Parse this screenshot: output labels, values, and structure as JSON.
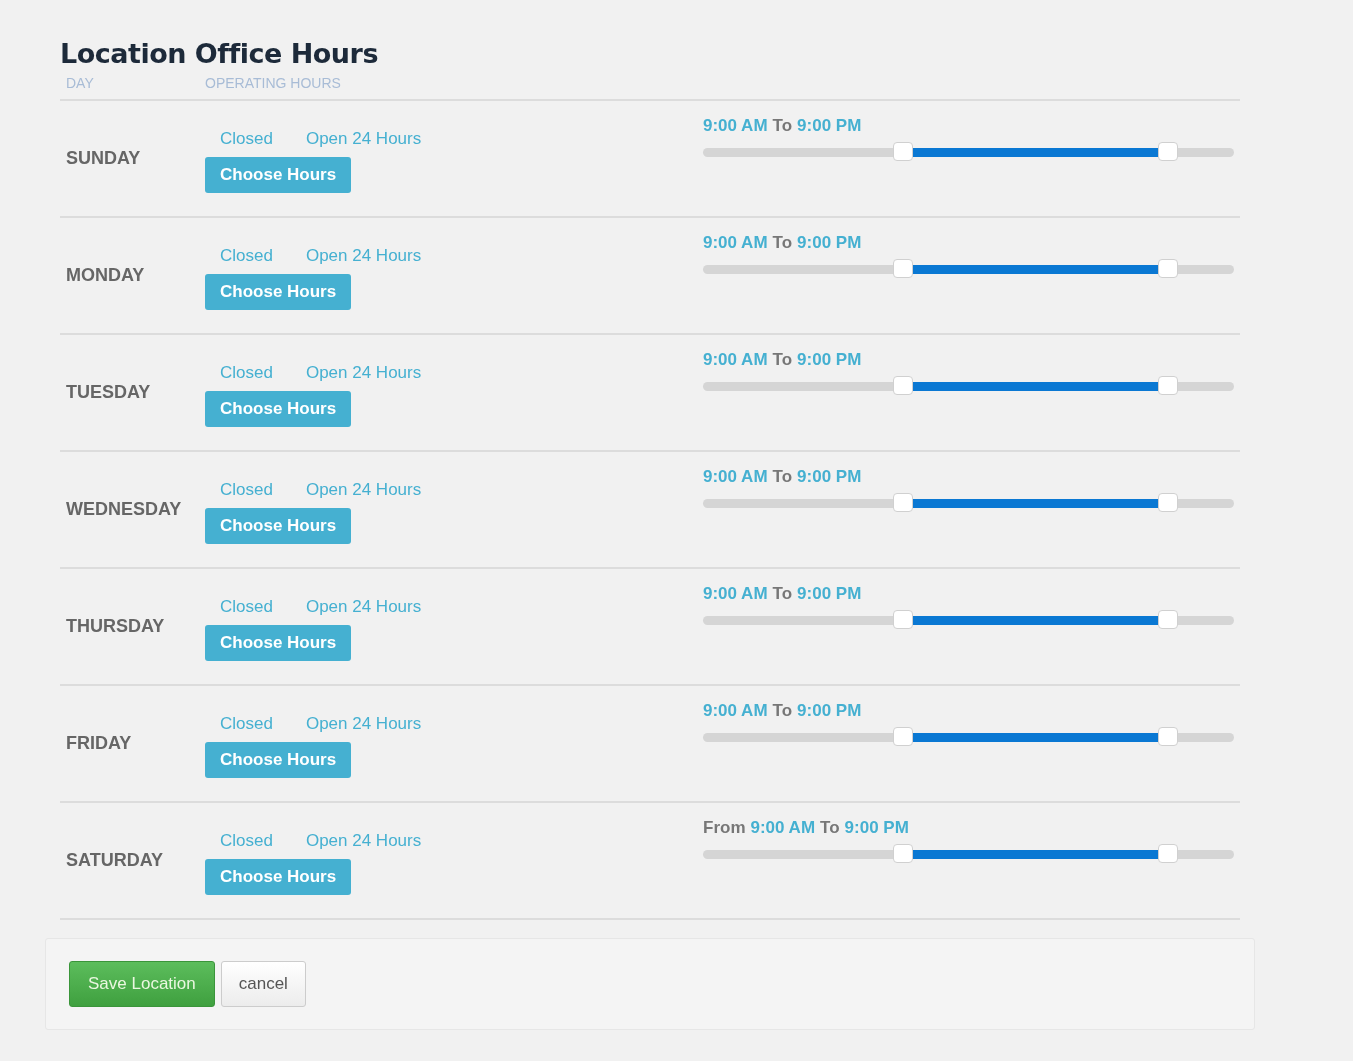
{
  "title": "Location Office Hours",
  "columns": [
    "DAY",
    "OPERATING HOURS"
  ],
  "days": [
    {
      "day": "SUNDAY",
      "closed": "Closed",
      "open24": "Open 24 Hours",
      "choose": "Choose Hours",
      "hours": {
        "start": "9:00 AM",
        "to": "To",
        "end": "9:00 PM"
      },
      "low": {
        "level": 0.377
      },
      "high": {
        "level": 0.875
      }
    },
    {
      "day": "MONDAY",
      "closed": "Closed",
      "open24": "Open 24 Hours",
      "choose": "Choose Hours",
      "hours": {
        "start": "9:00 AM",
        "to": "To",
        "end": "9:00 PM"
      },
      "low": {
        "level": 0.377
      },
      "high": {
        "level": 0.875
      }
    },
    {
      "day": "TUESDAY",
      "closed": "Closed",
      "open24": "Open 24 Hours",
      "choose": "Choose Hours",
      "hours": {
        "start": "9:00 AM",
        "to": "To",
        "end": "9:00 PM"
      },
      "low": {
        "level": 0.377
      },
      "high": {
        "level": 0.875
      }
    },
    {
      "day": "WEDNESDAY",
      "closed": "Closed",
      "open24": "Open 24 Hours",
      "choose": "Choose Hours",
      "hours": {
        "start": "9:00 AM",
        "to": "To",
        "end": "9:00 PM"
      },
      "low": {
        "level": 0.377
      },
      "high": {
        "level": 0.875
      }
    },
    {
      "day": "THURSDAY",
      "closed": "Closed",
      "open24": "Open 24 Hours",
      "choose": "Choose Hours",
      "hours": {
        "start": "9:00 AM",
        "to": "To",
        "end": "9:00 PM"
      },
      "low": {
        "level": 0.377
      },
      "high": {
        "level": 0.875
      }
    },
    {
      "day": "FRIDAY",
      "closed": "Closed",
      "open24": "Open 24 Hours",
      "choose": "Choose Hours",
      "hours": {
        "start": "9:00 AM",
        "to": "To",
        "end": "9:00 PM"
      },
      "low": {
        "level": 0.377
      },
      "high": {
        "level": 0.875
      }
    },
    {
      "day": "SATURDAY",
      "closed": "Closed",
      "open24": "Open 24 Hours",
      "choose": "Choose Hours",
      "hours": {
        "from": "From",
        "start": "9:00 AM",
        "to": "To",
        "end": "9:00 PM"
      },
      "low": {
        "level": 0.377
      },
      "high": {
        "level": 0.875
      }
    }
  ],
  "buttons": {
    "save": "Save Location",
    "cancel": "cancel"
  }
}
